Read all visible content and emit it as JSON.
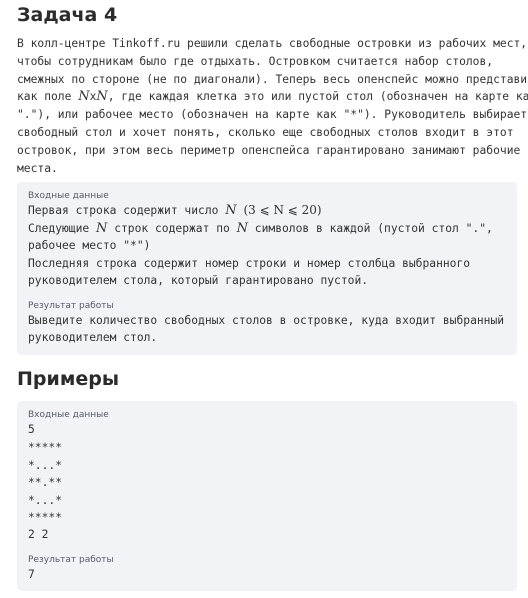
{
  "title": "Задача 4",
  "statement": {
    "lines": [
      "В колл-центре Tinkoff.ru решили сделать свободные островки из рабочих мест,",
      "чтобы сотрудникам было где отдыхать. Островком считается набор столов,",
      "смежных по стороне (не по диагонали). Теперь весь опенспейс можно представить",
      {
        "pre": "как поле ",
        "math": "N",
        "mid": "x",
        "math2": "N",
        "post": ", где каждая клетка это или пустой стол (обозначен на карте как"
      },
      "\".\"), или рабочее место (обозначен на карте как \"*\"). Руководитель выбирает",
      "свободный стол и хочет понять, сколько еще свободных столов входит в этот",
      "островок, при этом весь периметр опенспейса гарантировано занимают рабочие",
      "места."
    ]
  },
  "input_section": {
    "label": "Входные данные",
    "line1_pre": "Первая строка содержит число ",
    "line1_math": "N",
    "line1_cond": "(3 ⩽ N ⩽ 20)",
    "line2_pre": "Следующие ",
    "line2_math": "N",
    "line2_post": " строк содержат по ",
    "line2_math2": "N",
    "line2_post2": " символов в каждой (пустой стол \".\",",
    "line3": "рабочее место \"*\")",
    "line4": "Последняя строка содержит номер строки и номер столбца выбранного",
    "line5": "руководителем стола, который гарантировано пустой."
  },
  "output_section": {
    "label": "Результат работы",
    "line1": "Выведите количество свободных столов в островке, куда входит выбранный",
    "line2": "руководителем стол."
  },
  "examples_title": "Примеры",
  "example": {
    "input_label": "Входные данные",
    "input_lines": [
      "5",
      "*****",
      "*...*",
      "**.**",
      "*...*",
      "*****",
      "2 2"
    ],
    "output_label": "Результат работы",
    "output_value": "7"
  }
}
